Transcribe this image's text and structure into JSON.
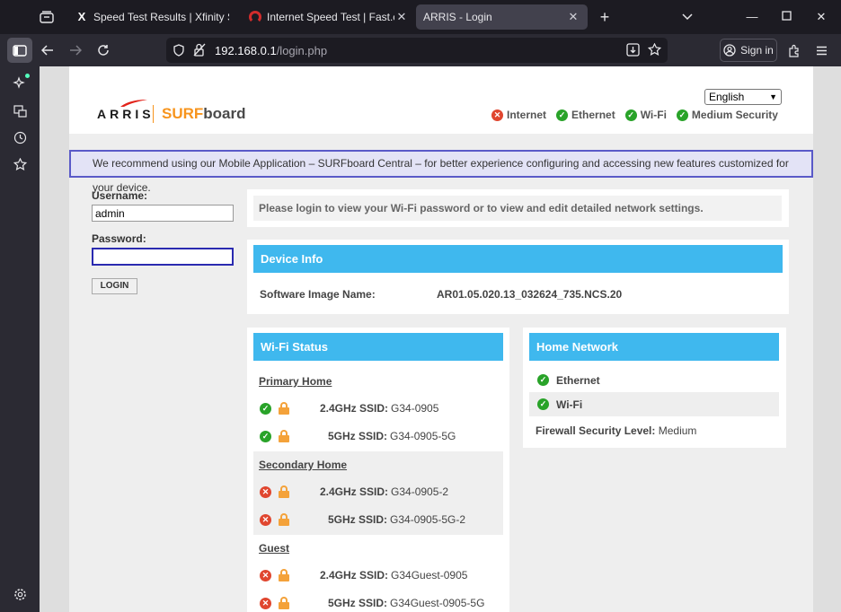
{
  "browser": {
    "tabs": [
      {
        "title": "Speed Test Results | Xfinity Speed",
        "favicon": "x-logo-icon",
        "active": false
      },
      {
        "title": "Internet Speed Test | Fast.com",
        "favicon": "fast-logo-icon",
        "active": false
      },
      {
        "title": "ARRIS - Login",
        "favicon": "",
        "active": true
      }
    ],
    "url_host": "192.168.0.1",
    "url_path": "/login.php",
    "signin_label": "Sign in"
  },
  "header": {
    "brand": "ARRIS",
    "product_orange": "SURF",
    "product_rest": "board",
    "language": "English",
    "status": [
      {
        "label": "Internet",
        "state": "error"
      },
      {
        "label": "Ethernet",
        "state": "ok"
      },
      {
        "label": "Wi-Fi",
        "state": "ok"
      },
      {
        "label": "Medium Security",
        "state": "ok"
      }
    ]
  },
  "banner": "We recommend using our Mobile Application – SURFboard Central – for better experience configuring and accessing new features customized for your device.",
  "login": {
    "username_label": "Username:",
    "username_value": "admin",
    "password_label": "Password:",
    "password_value": "",
    "button": "LOGIN"
  },
  "message": "Please login to view your Wi-Fi password or to view and edit detailed network settings.",
  "device_info": {
    "title": "Device Info",
    "software_label": "Software Image Name:",
    "software_value": "AR01.05.020.13_032624_735.NCS.20"
  },
  "wifi_status": {
    "title": "Wi-Fi Status",
    "sections": [
      {
        "name": "Primary Home",
        "rows": [
          {
            "band": "2.4GHz SSID:",
            "ssid": "G34-0905",
            "state": "ok"
          },
          {
            "band": "5GHz SSID:",
            "ssid": "G34-0905-5G",
            "state": "ok"
          }
        ]
      },
      {
        "name": "Secondary Home",
        "rows": [
          {
            "band": "2.4GHz SSID:",
            "ssid": "G34-0905-2",
            "state": "error"
          },
          {
            "band": "5GHz SSID:",
            "ssid": "G34-0905-5G-2",
            "state": "error"
          }
        ]
      },
      {
        "name": "Guest",
        "rows": [
          {
            "band": "2.4GHz SSID:",
            "ssid": "G34Guest-0905",
            "state": "error"
          },
          {
            "band": "5GHz SSID:",
            "ssid": "G34Guest-0905-5G",
            "state": "error"
          }
        ]
      }
    ]
  },
  "home_network": {
    "title": "Home Network",
    "items": [
      {
        "label": "Ethernet",
        "state": "ok"
      },
      {
        "label": "Wi-Fi",
        "state": "ok"
      }
    ],
    "firewall_label": "Firewall Security Level:",
    "firewall_value": "Medium"
  },
  "colors": {
    "accent_blue": "#3fb8ee",
    "ok_green": "#29a329",
    "error_red": "#e0462f",
    "brand_orange": "#f7941d",
    "banner_border": "#5a5ac8"
  }
}
